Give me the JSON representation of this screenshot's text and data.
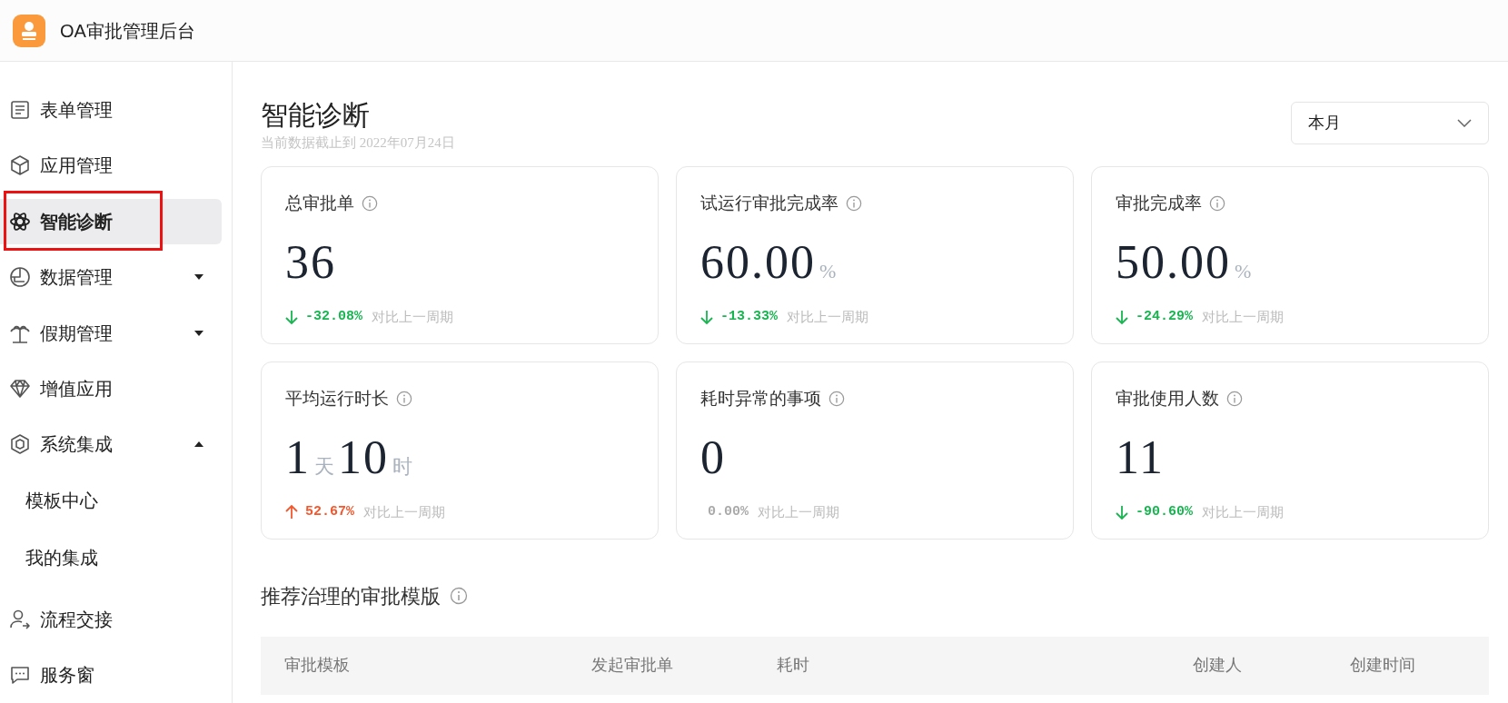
{
  "header": {
    "title": "OA审批管理后台"
  },
  "sidebar": {
    "items": [
      {
        "label": "表单管理",
        "selected": false,
        "outlined": false
      },
      {
        "label": "应用管理",
        "selected": false,
        "outlined": false
      },
      {
        "label": "智能诊断",
        "selected": true,
        "outlined": true
      },
      {
        "label": "数据管理",
        "selected": false,
        "outlined": false,
        "expanded": false
      },
      {
        "label": "假期管理",
        "selected": false,
        "outlined": false,
        "expanded": false
      },
      {
        "label": "增值应用",
        "selected": false,
        "outlined": false
      },
      {
        "label": "系统集成",
        "selected": false,
        "outlined": false,
        "expanded": true,
        "children": [
          {
            "label": "模板中心",
            "selected": false
          },
          {
            "label": "我的集成",
            "selected": false
          }
        ]
      },
      {
        "label": "流程交接",
        "selected": false,
        "outlined": false
      },
      {
        "label": "服务窗",
        "selected": false,
        "outlined": false
      }
    ]
  },
  "page": {
    "title": "智能诊断",
    "subtitle": "当前数据截止到 2022年07月24日",
    "period_select": {
      "value": "本月"
    }
  },
  "stats": [
    {
      "label": "总审批单",
      "value": [
        {
          "kind": "number",
          "text": "36"
        }
      ],
      "kind": "down",
      "change": "-32.08%",
      "compare": "对比上一周期"
    },
    {
      "label": "试运行审批完成率",
      "value": [
        {
          "kind": "number",
          "text": "60.00"
        },
        {
          "kind": "unit",
          "text": "%"
        }
      ],
      "kind": "down",
      "change": "-13.33%",
      "compare": "对比上一周期"
    },
    {
      "label": "审批完成率",
      "value": [
        {
          "kind": "number",
          "text": "50.00"
        },
        {
          "kind": "unit",
          "text": "%"
        }
      ],
      "kind": "down",
      "change": "-24.29%",
      "compare": "对比上一周期"
    },
    {
      "label": "平均运行时长",
      "value": [
        {
          "kind": "number",
          "text": "1"
        },
        {
          "kind": "unit",
          "text": "天"
        },
        {
          "kind": "number",
          "text": "10"
        },
        {
          "kind": "unit",
          "text": "时"
        }
      ],
      "kind": "up",
      "change": "52.67%",
      "compare": "对比上一周期"
    },
    {
      "label": "耗时异常的事项",
      "value": [
        {
          "kind": "number",
          "text": "0"
        }
      ],
      "kind": "none",
      "change": "0.00%",
      "compare": "对比上一周期"
    },
    {
      "label": "审批使用人数",
      "value": [
        {
          "kind": "number",
          "text": "11"
        }
      ],
      "kind": "down",
      "change": "-90.60%",
      "compare": "对比上一周期"
    }
  ],
  "recommend": {
    "title": "推荐治理的审批模版",
    "table": {
      "columns": [
        "审批模板",
        "发起审批单",
        "耗时",
        "创建人",
        "创建时间"
      ]
    }
  }
}
